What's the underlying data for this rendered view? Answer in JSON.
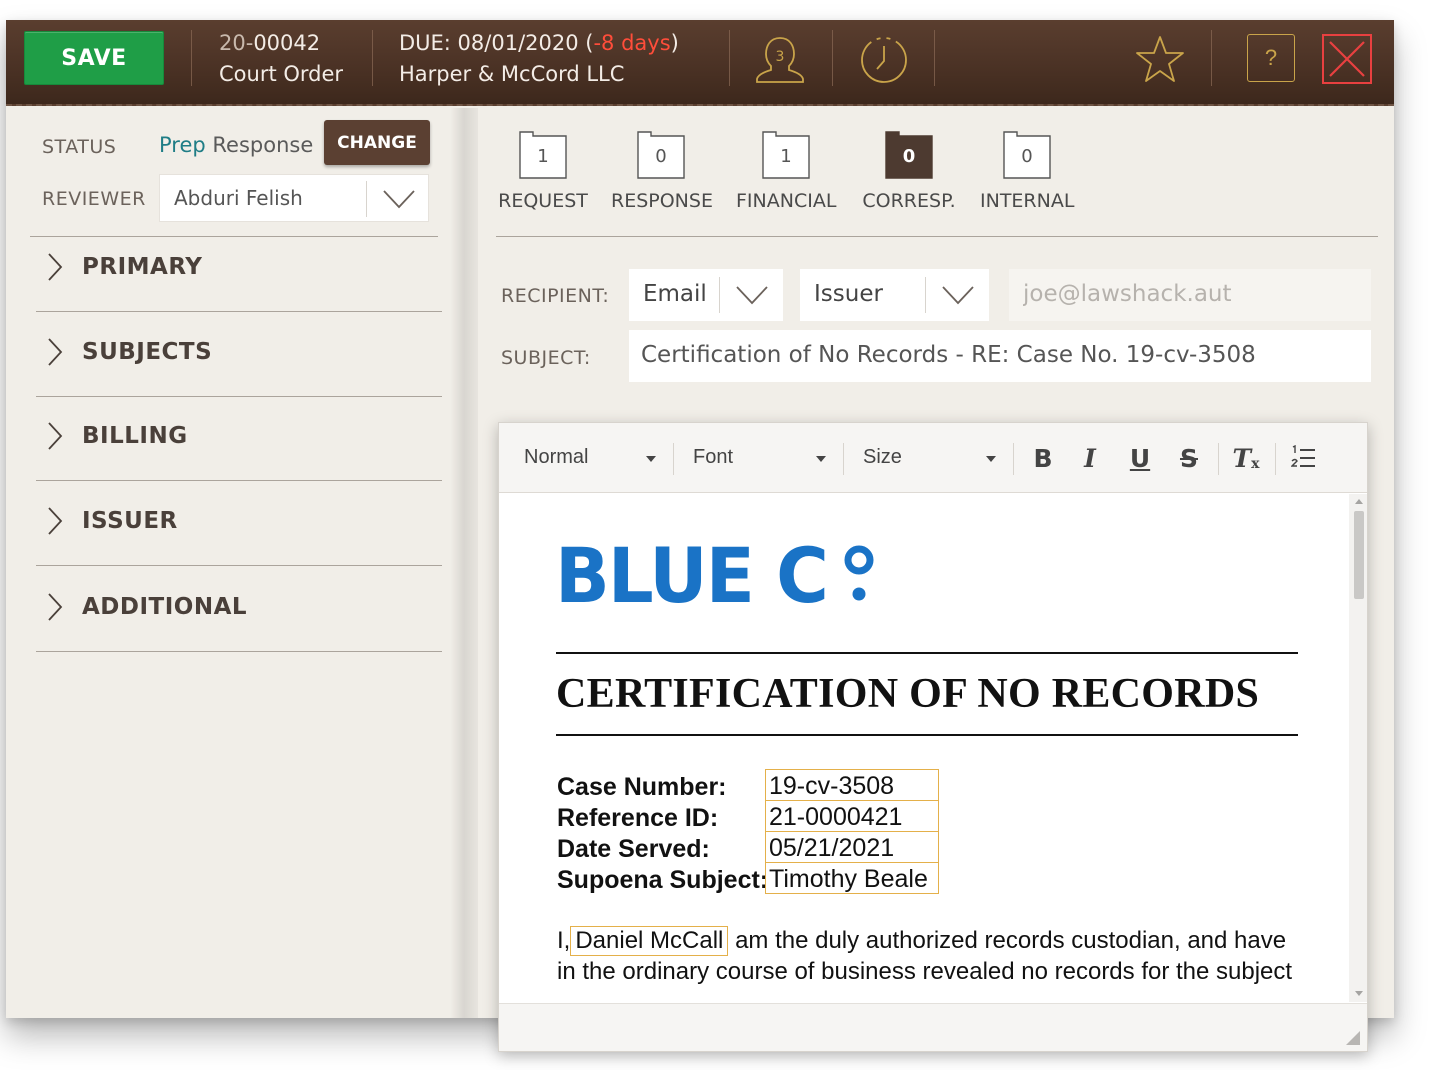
{
  "topbar": {
    "save_label": "SAVE",
    "case_prefix": "20-",
    "case_number": "00042",
    "case_type": "Court Order",
    "due_label": "DUE: 08/01/2020 (",
    "due_overdue": "-8 days",
    "due_close": ")",
    "firm": "Harper & McCord LLC",
    "assignee_count": "3",
    "help_label": "?"
  },
  "left": {
    "status_label": "STATUS",
    "status_value_part1": "Prep",
    "status_value_part2": "Response",
    "change_label": "CHANGE",
    "reviewer_label": "REVIEWER",
    "reviewer_value": "Abduri Felish",
    "sections": [
      "PRIMARY",
      "SUBJECTS",
      "BILLING",
      "ISSUER",
      "ADDITIONAL"
    ]
  },
  "tabs": [
    {
      "count": "1",
      "label": "REQUEST",
      "active": false
    },
    {
      "count": "0",
      "label": "RESPONSE",
      "active": false
    },
    {
      "count": "1",
      "label": "FINANCIAL",
      "active": false
    },
    {
      "count": "0",
      "label": "CORRESP.",
      "active": true
    },
    {
      "count": "0",
      "label": "INTERNAL",
      "active": false
    }
  ],
  "form": {
    "recipient_label": "RECIPIENT:",
    "recipient_method": "Email",
    "recipient_party": "Issuer",
    "recipient_email": "joe@lawshack.aut",
    "subject_label": "SUBJECT:",
    "subject_value": "Certification of No Records - RE: Case No. 19-cv-3508"
  },
  "editor": {
    "style_select": "Normal",
    "font_select": "Font",
    "size_select": "Size",
    "bold": "B",
    "italic": "I",
    "underline": "U",
    "strike": "S",
    "clear": "T",
    "clear_sub": "x"
  },
  "document": {
    "logo_text": "BLUE C",
    "title": "CERTIFICATION OF NO RECORDS",
    "fields": [
      {
        "label": "Case Number:",
        "value": "19-cv-3508"
      },
      {
        "label": "Reference ID:",
        "value": " 21-0000421"
      },
      {
        "label": "Date Served:",
        "value": "05/21/2021"
      },
      {
        "label": "Supoena Subject:",
        "value": "Timothy Beale"
      }
    ],
    "para_prefix": "I,",
    "custodian": "Daniel McCall",
    "para_line1_rest": "am the duly authorized records custodian, and have",
    "para_line2": "in the ordinary course of business revealed no records for the subject"
  },
  "colors": {
    "save_green": "#1f9e47",
    "overdue_red": "#ff4d3a",
    "brand_blue": "#1a73c6",
    "topbar_brown": "#4b3225",
    "highlight_box": "#e4b04a"
  }
}
